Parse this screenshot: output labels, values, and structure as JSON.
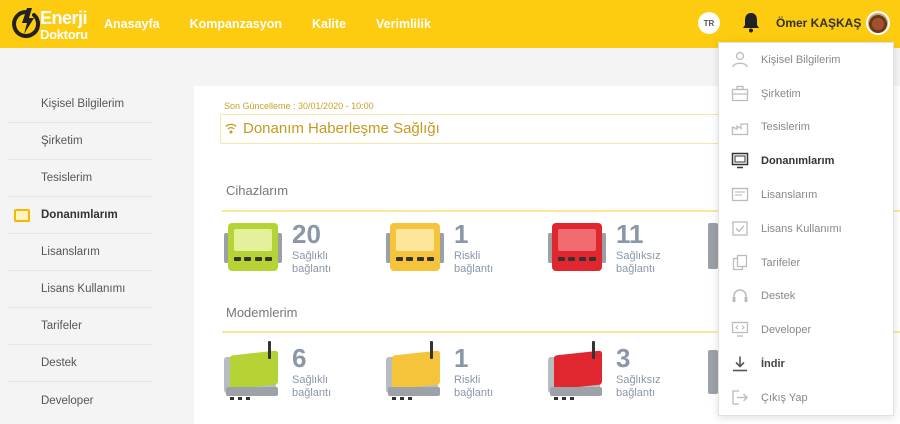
{
  "header": {
    "logo": {
      "line1": "Enerji",
      "line2": "Doktoru"
    },
    "nav": [
      "Anasayfa",
      "Kompanzasyon",
      "Kalite",
      "Verimlilik"
    ],
    "lang": "TR",
    "username": "Ömer KAŞKAŞ"
  },
  "sidebar": {
    "items": [
      {
        "label": "Kişisel Bilgilerim"
      },
      {
        "label": "Şirketim"
      },
      {
        "label": "Tesislerim"
      },
      {
        "label": "Donanımlarım"
      },
      {
        "label": "Lisanslarım"
      },
      {
        "label": "Lisans Kullanımı"
      },
      {
        "label": "Tarifeler"
      },
      {
        "label": "Destek"
      },
      {
        "label": "Developer"
      }
    ]
  },
  "main": {
    "updated": "Son Güncelleme : 30/01/2020 - 10:00",
    "title": "Donanım Haberleşme Sağlığı",
    "devices": {
      "title": "Cihazlarım",
      "stats": [
        {
          "count": "20",
          "line1": "Sağlıklı",
          "line2": "bağlantı",
          "color": "#b5d334"
        },
        {
          "count": "1",
          "line1": "Riskli",
          "line2": "bağlantı",
          "color": "#f6c43a"
        },
        {
          "count": "11",
          "line1": "Sağlıksız",
          "line2": "bağlantı",
          "color": "#e0262f"
        }
      ]
    },
    "modems": {
      "title": "Modemlerim",
      "stats": [
        {
          "count": "6",
          "line1": "Sağlıklı",
          "line2": "bağlantı",
          "color": "#b5d334"
        },
        {
          "count": "1",
          "line1": "Riskli",
          "line2": "bağlantı",
          "color": "#f6c43a"
        },
        {
          "count": "3",
          "line1": "Sağlıksız",
          "line2": "bağlantı",
          "color": "#e0262f"
        }
      ]
    }
  },
  "dropdown": {
    "items": [
      {
        "label": "Kişisel Bilgilerim",
        "icon": "user-icon"
      },
      {
        "label": "Şirketim",
        "icon": "briefcase-icon"
      },
      {
        "label": "Tesislerim",
        "icon": "factory-icon"
      },
      {
        "label": "Donanımlarım",
        "icon": "monitor-icon"
      },
      {
        "label": "Lisanslarım",
        "icon": "license-icon"
      },
      {
        "label": "Lisans Kullanımı",
        "icon": "checkbox-icon"
      },
      {
        "label": "Tarifeler",
        "icon": "documents-icon"
      },
      {
        "label": "Destek",
        "icon": "headset-icon"
      },
      {
        "label": "Developer",
        "icon": "developer-icon"
      },
      {
        "label": "İndir",
        "icon": "download-icon"
      },
      {
        "label": "Çıkış Yap",
        "icon": "logout-icon"
      }
    ]
  },
  "colors": {
    "brand": "#fdcb10",
    "healthy": "#b5d334",
    "risky": "#f6c43a",
    "unhealthy": "#e0262f"
  }
}
